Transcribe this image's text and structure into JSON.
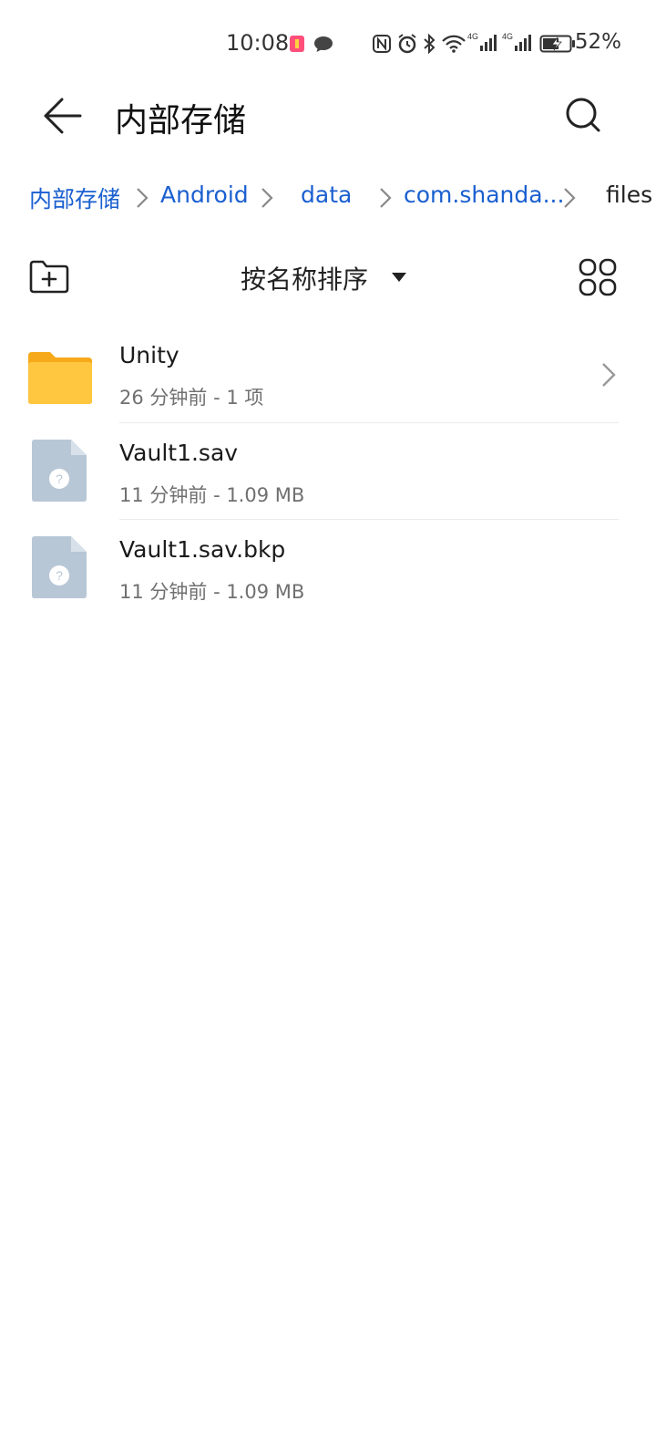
{
  "status": {
    "time": "10:08",
    "network_1": "4G",
    "network_2": "4G",
    "battery": "52%"
  },
  "header": {
    "title": "内部存储"
  },
  "breadcrumb": [
    "内部存储",
    "Android",
    "data",
    "com.shanda...",
    "files"
  ],
  "toolbar": {
    "sort_label": "按名称排序"
  },
  "files": [
    {
      "name": "Unity",
      "meta": "26 分钟前 - 1 项",
      "type": "folder"
    },
    {
      "name": "Vault1.sav",
      "meta": "11 分钟前 - 1.09 MB",
      "type": "unknown"
    },
    {
      "name": "Vault1.sav.bkp",
      "meta": "11 分钟前 - 1.09 MB",
      "type": "unknown"
    }
  ],
  "colors": {
    "accent": "#1a5fd0",
    "folder": "#ffc640",
    "unknown_file": "#b8c7d6"
  }
}
